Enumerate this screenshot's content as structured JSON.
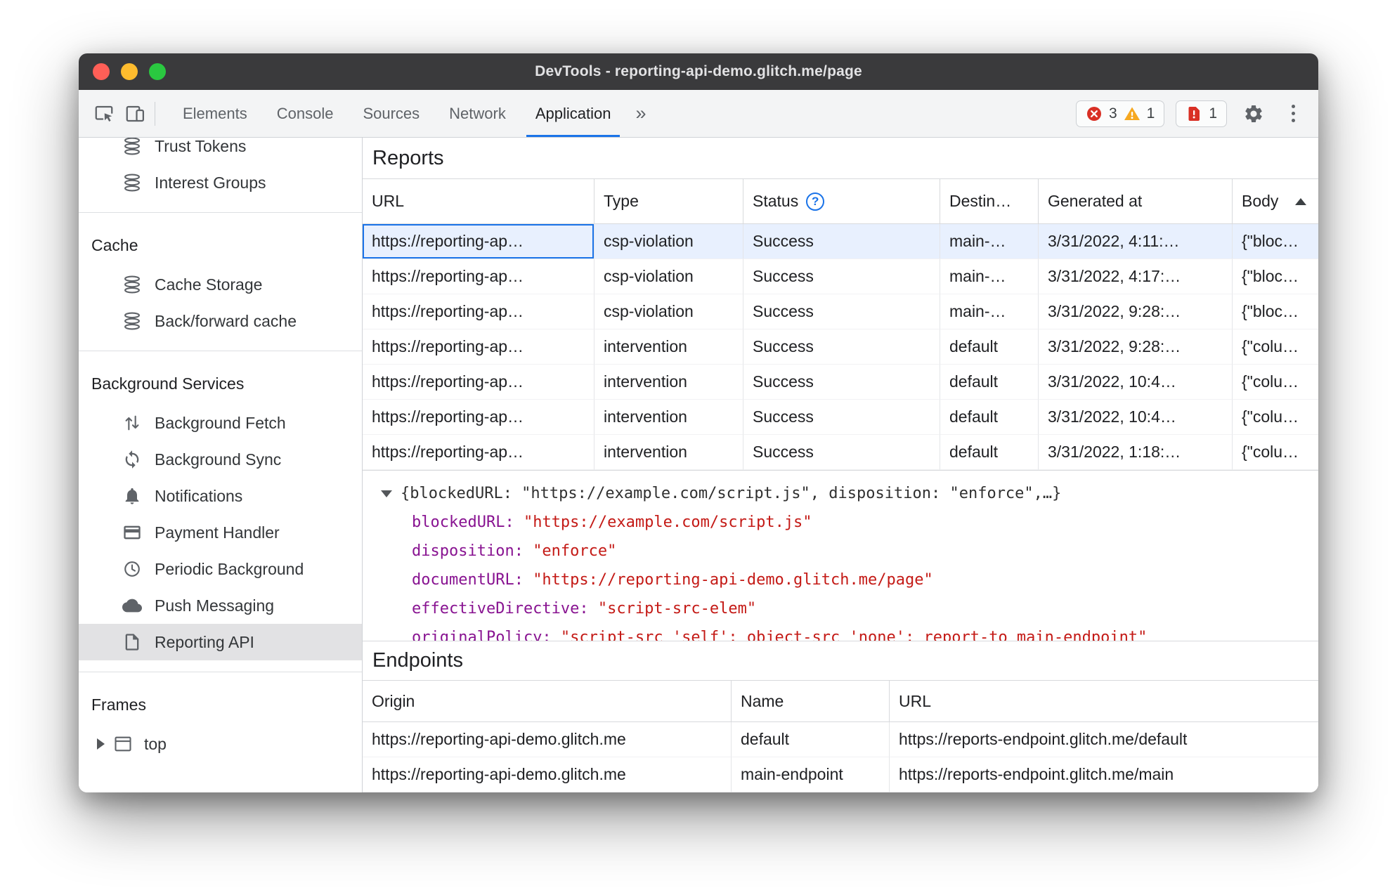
{
  "window": {
    "title": "DevTools - reporting-api-demo.glitch.me/page"
  },
  "toolbar": {
    "tabs": [
      {
        "label": "Elements"
      },
      {
        "label": "Console"
      },
      {
        "label": "Sources"
      },
      {
        "label": "Network"
      },
      {
        "label": "Application"
      }
    ],
    "more_tabs_symbol": "»",
    "error_count": "3",
    "warning_count": "1",
    "issue_count": "1"
  },
  "icons": {
    "help": "?"
  },
  "colors": {
    "accent": "#1a73e8",
    "error": "#d93025",
    "warning": "#f6a821",
    "selection": "#e8f0fe"
  },
  "sidebar": {
    "top_items": [
      {
        "label": "Trust Tokens"
      },
      {
        "label": "Interest Groups"
      }
    ],
    "sections": [
      {
        "title": "Cache",
        "items": [
          {
            "label": "Cache Storage"
          },
          {
            "label": "Back/forward cache"
          }
        ]
      },
      {
        "title": "Background Services",
        "items": [
          {
            "label": "Background Fetch"
          },
          {
            "label": "Background Sync"
          },
          {
            "label": "Notifications"
          },
          {
            "label": "Payment Handler"
          },
          {
            "label": "Periodic Background"
          },
          {
            "label": "Push Messaging"
          },
          {
            "label": "Reporting API",
            "selected": true
          }
        ]
      },
      {
        "title": "Frames",
        "items": [
          {
            "label": "top"
          }
        ]
      }
    ]
  },
  "reports": {
    "heading": "Reports",
    "columns": {
      "url": "URL",
      "type": "Type",
      "status": "Status",
      "destination": "Destin…",
      "generated": "Generated at",
      "body": "Body"
    },
    "rows": [
      {
        "url": "https://reporting-ap…",
        "type": "csp-violation",
        "status": "Success",
        "destination": "main-…",
        "generated": "3/31/2022, 4:11:…",
        "body": "{\"bloc…"
      },
      {
        "url": "https://reporting-ap…",
        "type": "csp-violation",
        "status": "Success",
        "destination": "main-…",
        "generated": "3/31/2022, 4:17:…",
        "body": "{\"bloc…"
      },
      {
        "url": "https://reporting-ap…",
        "type": "csp-violation",
        "status": "Success",
        "destination": "main-…",
        "generated": "3/31/2022, 9:28:…",
        "body": "{\"bloc…"
      },
      {
        "url": "https://reporting-ap…",
        "type": "intervention",
        "status": "Success",
        "destination": "default",
        "generated": "3/31/2022, 9:28:…",
        "body": "{\"colu…"
      },
      {
        "url": "https://reporting-ap…",
        "type": "intervention",
        "status": "Success",
        "destination": "default",
        "generated": "3/31/2022, 10:4…",
        "body": "{\"colu…"
      },
      {
        "url": "https://reporting-ap…",
        "type": "intervention",
        "status": "Success",
        "destination": "default",
        "generated": "3/31/2022, 10:4…",
        "body": "{\"colu…"
      },
      {
        "url": "https://reporting-ap…",
        "type": "intervention",
        "status": "Success",
        "destination": "default",
        "generated": "3/31/2022, 1:18:…",
        "body": "{\"colu…"
      }
    ]
  },
  "detail": {
    "preview": "{blockedURL: \"https://example.com/script.js\", disposition: \"enforce\",…}",
    "props": [
      {
        "key": "blockedURL: ",
        "value": "\"https://example.com/script.js\""
      },
      {
        "key": "disposition: ",
        "value": "\"enforce\""
      },
      {
        "key": "documentURL: ",
        "value": "\"https://reporting-api-demo.glitch.me/page\""
      },
      {
        "key": "effectiveDirective: ",
        "value": "\"script-src-elem\""
      },
      {
        "key": "originalPolicy: ",
        "value": "\"script-src 'self'; object-src 'none'; report-to main-endpoint\""
      }
    ]
  },
  "endpoints": {
    "heading": "Endpoints",
    "columns": {
      "origin": "Origin",
      "name": "Name",
      "url": "URL"
    },
    "rows": [
      {
        "origin": "https://reporting-api-demo.glitch.me",
        "name": "default",
        "url": "https://reports-endpoint.glitch.me/default"
      },
      {
        "origin": "https://reporting-api-demo.glitch.me",
        "name": "main-endpoint",
        "url": "https://reports-endpoint.glitch.me/main"
      }
    ]
  }
}
